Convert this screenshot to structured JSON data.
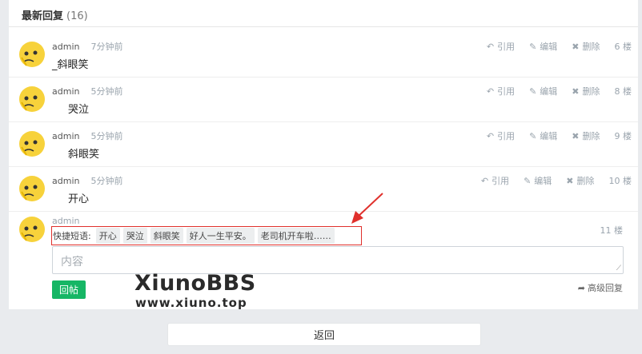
{
  "header": {
    "title": "最新回复",
    "count": "(16)"
  },
  "actions": {
    "quote": "引用",
    "edit": "编辑",
    "delete": "删除"
  },
  "posts": [
    {
      "user": "admin",
      "time": "7分钟前",
      "content": "_斜眼笑",
      "floor": "6 楼"
    },
    {
      "user": "admin",
      "time": "5分钟前",
      "content": "哭泣",
      "floor": "8 楼"
    },
    {
      "user": "admin",
      "time": "5分钟前",
      "content": "斜眼笑",
      "floor": "9 楼"
    },
    {
      "user": "admin",
      "time": "5分钟前",
      "content": "开心",
      "floor": "10 楼"
    }
  ],
  "reply": {
    "user": "admin",
    "quick_label": "快捷短语:",
    "chips": [
      "开心",
      "哭泣",
      "斜眼笑",
      "好人一生平安。",
      "老司机开车啦……"
    ],
    "floor": "11 楼",
    "placeholder": "内容",
    "submit": "回帖",
    "advanced": "高级回复"
  },
  "watermark": {
    "line1": "XiunoBBS",
    "line2": "www.xiuno.top"
  },
  "footer": {
    "back": "返回"
  },
  "colors": {
    "accent_green": "#16b665",
    "highlight_red": "#e0302c",
    "muted": "#9aa4ad"
  },
  "icons": {
    "avatar": "avatar-face-icon",
    "quote": "reply-arrow-icon",
    "edit": "edit-pencil-icon",
    "delete": "close-x-icon"
  }
}
